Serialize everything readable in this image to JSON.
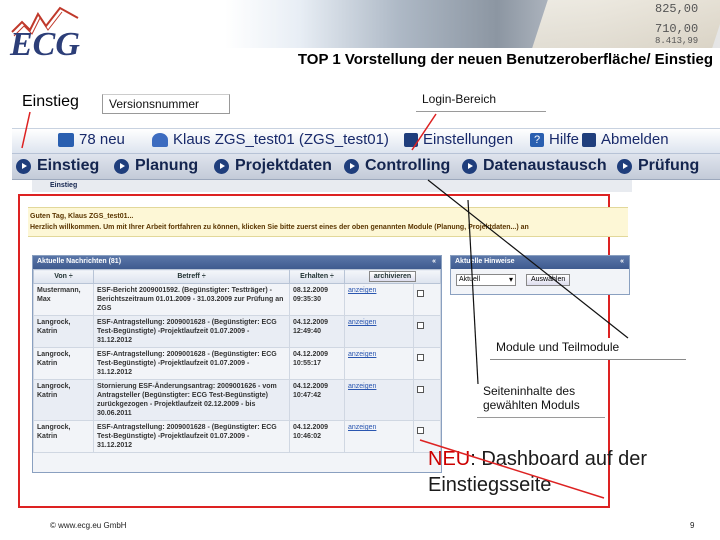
{
  "logo": {
    "text": "ECG"
  },
  "header": {
    "title": "TOP 1 Vorstellung der neuen Benutzeroberfläche/ Einstieg",
    "photo_numbers": [
      "825,00",
      "710,00",
      "8.413,99"
    ]
  },
  "slide_label": "Einstieg",
  "callouts": {
    "version": "Versionsnummer",
    "login": "Login-Bereich",
    "module": "Module und Teilmodule",
    "content": "Seiteninhalte des gewählten Moduls",
    "neu_prefix": "NEU",
    "neu_text": ": Dashboard auf der Einstiegsseite"
  },
  "topbar": {
    "messages": "78 neu",
    "user": "Klaus ZGS_test01 (ZGS_test01)",
    "settings": "Einstellungen",
    "help": "Hilfe",
    "logout": "Abmelden"
  },
  "nav": [
    "Einstieg",
    "Planung",
    "Projektdaten",
    "Controlling",
    "Datenaustausch",
    "Prüfung"
  ],
  "breadcrumb": "Einstieg",
  "welcome": {
    "greeting": "Guten Tag, Klaus ZGS_test01...",
    "text": "Herzlich willkommen. Um mit Ihrer Arbeit fortfahren zu können, klicken Sie bitte zuerst eines der oben genannten Module (Planung, Projektdaten...) an"
  },
  "news": {
    "title": "Aktuelle Nachrichten (81)",
    "close": "«",
    "columns": [
      "Von ÷",
      "Betreff ÷",
      "Erhalten ÷"
    ],
    "archive_button": "archivieren",
    "rows": [
      {
        "from": "Mustermann, Max",
        "subject": "ESF-Bericht 2009001592. (Begünstigter: Testträger) - Berichtszeitraum 01.01.2009 - 31.03.2009 zur Prüfung an ZGS",
        "received": "08.12.2009 09:35:30",
        "link": "anzeigen"
      },
      {
        "from": "Langrock, Katrin",
        "subject": "ESF-Antragstellung: 2009001628 - (Begünstigter: ECG Test-Begünstigte) -Projektlaufzeit 01.07.2009 - 31.12.2012",
        "received": "04.12.2009 12:49:40",
        "link": "anzeigen"
      },
      {
        "from": "Langrock, Katrin",
        "subject": "ESF-Antragstellung: 2009001628 - (Begünstigter: ECG Test-Begünstigte) -Projektlaufzeit 01.07.2009 - 31.12.2012",
        "received": "04.12.2009 10:55:17",
        "link": "anzeigen"
      },
      {
        "from": "Langrock, Katrin",
        "subject": "Stornierung ESF-Änderungsantrag: 2009001626 - vom Antragsteller (Begünstigter: ECG Test-Begünstigte) zurückgezogen - Projektlaufzeit 02.12.2009 - bis 30.06.2011",
        "received": "04.12.2009 10:47:42",
        "link": "anzeigen"
      },
      {
        "from": "Langrock, Katrin",
        "subject": "ESF-Antragstellung: 2009001628 - (Begünstigter: ECG Test-Begünstigte) -Projektlaufzeit 01.07.2009 - 31.12.2012",
        "received": "04.12.2009 10:46:02",
        "link": "anzeigen"
      }
    ]
  },
  "hints": {
    "title": "Aktuelle Hinweise",
    "close": "«",
    "select_value": "Aktuell",
    "button": "Auswählen"
  },
  "footer": {
    "copyright": "© www.ecg.eu GmbH",
    "page": "9"
  },
  "colors": {
    "accent_red": "#d22222",
    "navy": "#14254f",
    "link_blue": "#2a56b0"
  }
}
